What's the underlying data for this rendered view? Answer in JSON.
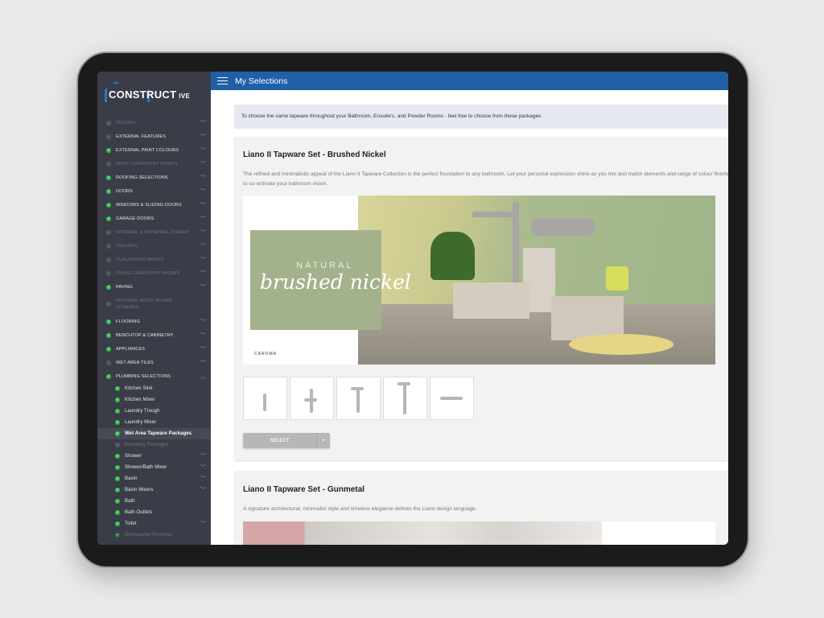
{
  "app": {
    "logo_text": "CONSTRUCT",
    "logo_suffix": "IVE",
    "title": "My Selections"
  },
  "colors": {
    "header": "#1f60a6",
    "sidebar": "#3a3d48",
    "done": "#2fbf4a"
  },
  "sidebar": {
    "items": [
      {
        "label": "RENDER",
        "status": "none",
        "dim": true,
        "chevron": "down"
      },
      {
        "label": "EXTERNAL FEATURES",
        "status": "pending",
        "dim": false,
        "chevron": "down"
      },
      {
        "label": "EXTERNAL PAINT COLOURS",
        "status": "done",
        "dim": false,
        "chevron": "down"
      },
      {
        "label": "ROOF CARPENTRY WORKS",
        "status": "none",
        "dim": true,
        "chevron": "down"
      },
      {
        "label": "ROOFING SELECTIONS",
        "status": "done",
        "dim": false,
        "chevron": "down"
      },
      {
        "label": "DOORS",
        "status": "done",
        "dim": false,
        "chevron": "down"
      },
      {
        "label": "WINDOWS & SLIDING DOORS",
        "status": "done",
        "dim": false,
        "chevron": "down"
      },
      {
        "label": "GARAGE DOORS",
        "status": "done",
        "dim": false,
        "chevron": "down"
      },
      {
        "label": "INTERNAL & EXTERNAL JOINERY",
        "status": "none",
        "dim": true,
        "chevron": "down"
      },
      {
        "label": "CEILINGS",
        "status": "none",
        "dim": true,
        "chevron": "down"
      },
      {
        "label": "PLASTERING WORKS",
        "status": "none",
        "dim": true,
        "chevron": "down"
      },
      {
        "label": "FIXING CARPENTRY WORKS",
        "status": "none",
        "dim": true,
        "chevron": "down"
      },
      {
        "label": "PAVING",
        "status": "done",
        "dim": false,
        "chevron": "down"
      },
      {
        "label": "INTERNAL MOOD BOARD SCHEMES",
        "status": "none",
        "dim": true,
        "chevron": "",
        "two": true
      },
      {
        "label": "FLOORING",
        "status": "done",
        "dim": false,
        "chevron": "down"
      },
      {
        "label": "BENCHTOP & CABINETRY",
        "status": "done",
        "dim": false,
        "chevron": "down"
      },
      {
        "label": "APPLIANCES",
        "status": "done",
        "dim": false,
        "chevron": "down"
      },
      {
        "label": "WET AREA TILES",
        "status": "pending",
        "dim": false,
        "chevron": "down"
      },
      {
        "label": "PLUMBING SELECTIONS",
        "status": "done",
        "dim": false,
        "chevron": "up"
      }
    ],
    "subitems": [
      {
        "label": "Kitchen Sink",
        "status": "done",
        "chevron": ""
      },
      {
        "label": "Kitchen Mixer",
        "status": "done",
        "chevron": ""
      },
      {
        "label": "Laundry Trough",
        "status": "done",
        "chevron": ""
      },
      {
        "label": "Laundry Mixer",
        "status": "done",
        "chevron": ""
      },
      {
        "label": "Wet Area Tapware Packages",
        "status": "done",
        "chevron": "",
        "active": true
      },
      {
        "label": "Plumbing Packages",
        "status": "none",
        "chevron": "",
        "dim": true
      },
      {
        "label": "Shower",
        "status": "done",
        "chevron": "down"
      },
      {
        "label": "Shower/Bath Mixer",
        "status": "done",
        "chevron": "down"
      },
      {
        "label": "Basin",
        "status": "done",
        "chevron": "down"
      },
      {
        "label": "Basin Mixers",
        "status": "done",
        "chevron": "down"
      },
      {
        "label": "Bath",
        "status": "done",
        "chevron": ""
      },
      {
        "label": "Bath Outlets",
        "status": "done",
        "chevron": ""
      },
      {
        "label": "Toilet",
        "status": "done",
        "chevron": "down"
      },
      {
        "label": "Dishwasher Provision",
        "status": "done",
        "chevron": "",
        "dim": true
      }
    ]
  },
  "main": {
    "banner": "To choose the same tapware throughout your Bathroom, Ensuite's, and Powder Rooms - feel free to choose from these packages",
    "cards": [
      {
        "title": "Liano II Tapware Set - Brushed Nickel",
        "description": "The refined and minimalistic appeal of the Liano II Tapware Collection is the perfect foundation to any bathroom. Let your personal expression shine as you mix and match elements and range of colour finishes to co-ordinate your bathroom vision.",
        "hero_line1": "NATURAL",
        "hero_line2": "brushed nickel",
        "hero_brand": "CAROMA",
        "select_label": "SELECT"
      },
      {
        "title": "Liano II Tapware Set - Gunmetal",
        "description": "A signature architectural, minimalist style and timeless elegance defines the Liano design language."
      }
    ]
  }
}
